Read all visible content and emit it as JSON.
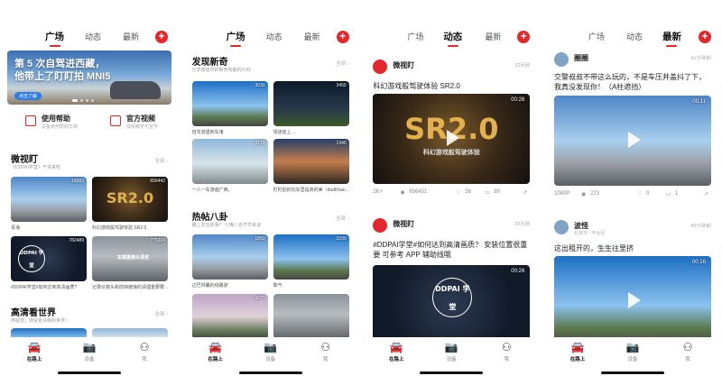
{
  "colors": {
    "accent": "#e5262b",
    "link_blue": "#2d7de2"
  },
  "tabs": [
    "广场",
    "动态",
    "最新"
  ],
  "plus_label": "+",
  "bottom_nav": [
    {
      "icon": "car-icon",
      "label": "在路上"
    },
    {
      "icon": "camera-icon",
      "label": "设备"
    },
    {
      "icon": "user-icon",
      "label": "我"
    }
  ],
  "screen1": {
    "banner": {
      "line1": "第 5 次自驾进西藏，",
      "line2": "他带上了盯盯拍 MNI5",
      "button": "点击了解"
    },
    "quick": [
      {
        "title": "使用帮助",
        "sub": "设备使用帮助文档"
      },
      {
        "title": "官方视频",
        "sub": "视频教学与宣传"
      }
    ],
    "weishiding": {
      "title": "微视盯",
      "sub": "《DDPAI学堂》干货来啦",
      "more": "全部 ›",
      "items": [
        {
          "tag": "18083",
          "caption": "青海"
        },
        {
          "tag": "656442",
          "caption": "科幻游戏般驾驶体验 SR2.0"
        },
        {
          "tag": "782489",
          "caption": "#DDPAI学堂#如何达到高清画质?"
        },
        {
          "tag": "775314",
          "caption": "记录仪镜头和前挡玻璃的清理重要要…"
        }
      ],
      "sr_label": "SR2.0",
      "ddp_label": "DDPAI 学堂",
      "clean_label": "车载摄像头清洗"
    },
    "hd": {
      "title": "高清看世界",
      "sub": "用视觉，感受更清晰的世界！",
      "more": "全部 ›"
    }
  },
  "screen2": {
    "discover": {
      "title": "发现新奇",
      "sub": "分享旅途中的新奇有趣的片刻",
      "more": "全部 ›",
      "items": [
        {
          "tag": "3030",
          "caption": "自驾游遇到车堵"
        },
        {
          "tag": "3450",
          "caption": "球迷徒上…"
        },
        {
          "tag": "3172",
          "caption": "一人一车游遍广西。"
        },
        {
          "tag": "1340",
          "caption": "盯盯拍的玩车里是真的美（dudKhan…"
        }
      ]
    },
    "hot": {
      "title": "热帖八卦",
      "sub": "路上发生的事？ 七嘴八舌齐齐来谈",
      "more": "全部 ›",
      "items": [
        {
          "tag": "1860",
          "caption": "边巴林囊的绕路驶"
        },
        {
          "tag": "3290",
          "caption": "敢气"
        },
        {
          "tag": "4270",
          "caption": ""
        },
        {
          "tag": "",
          "caption": ""
        }
      ]
    }
  },
  "screen3": {
    "posts": [
      {
        "author": "微视盯",
        "time": "12天前",
        "text": "科幻游戏般驾驶体验 SR2.0",
        "duration": "00:26",
        "video_label": "SR2.0",
        "video_sub": "科幻游戏般驾驶体验",
        "stats": {
          "quality": "2K+",
          "views": "656451",
          "likes": "56",
          "comments": "80"
        }
      },
      {
        "author": "微视盯",
        "time": "20天前",
        "text": "#DDPAI学堂#如何达到高清画质？ 安装位置很重要 可参考 APP 辅助线哦",
        "duration": "00:26",
        "video_label": "DDPAI 学堂"
      }
    ]
  },
  "screen4": {
    "posts": [
      {
        "author": "圈圈",
        "time": "41分钟前",
        "text": "交警叔叔不带这么玩的，不是车压井盖抖了下，我真没发现你！（A柱遮挡）",
        "duration": "00:11",
        "stats": {
          "quality": "1080P",
          "views": "223",
          "likes": "0",
          "comments": "1"
        }
      },
      {
        "author": "波怪",
        "location": "北京市 · 丰台区",
        "time": "49分钟前",
        "text": "这出租开的，生生往里挤",
        "duration": "00:16"
      }
    ]
  }
}
